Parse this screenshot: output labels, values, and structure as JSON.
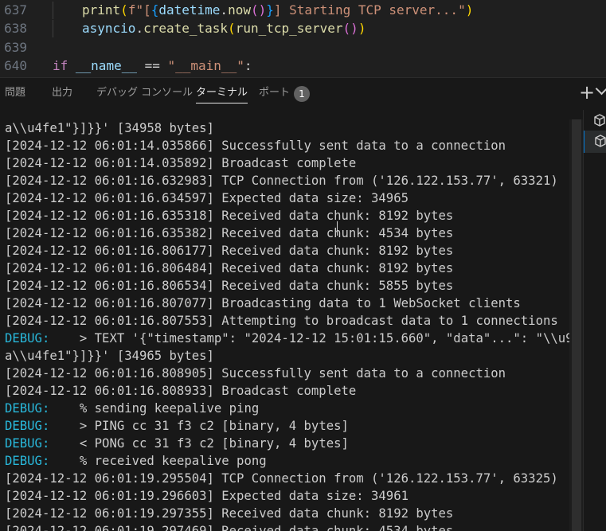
{
  "editor": {
    "lines": [
      {
        "num": "637",
        "indent": 1,
        "tokens": [
          {
            "t": "print",
            "c": "c-fn"
          },
          {
            "t": "(",
            "c": "c-br1"
          },
          {
            "t": "f\"[",
            "c": "c-str"
          },
          {
            "t": "{",
            "c": "c-br3"
          },
          {
            "t": "datetime",
            "c": "c-var"
          },
          {
            "t": ".",
            "c": "c-pun"
          },
          {
            "t": "now",
            "c": "c-fn"
          },
          {
            "t": "()",
            "c": "c-br2"
          },
          {
            "t": "}",
            "c": "c-br3"
          },
          {
            "t": "] Starting TCP server...\"",
            "c": "c-str"
          },
          {
            "t": ")",
            "c": "c-br1"
          }
        ]
      },
      {
        "num": "638",
        "indent": 1,
        "tokens": [
          {
            "t": "asyncio",
            "c": "c-var"
          },
          {
            "t": ".",
            "c": "c-pun"
          },
          {
            "t": "create_task",
            "c": "c-fn"
          },
          {
            "t": "(",
            "c": "c-br1"
          },
          {
            "t": "run_tcp_server",
            "c": "c-fn"
          },
          {
            "t": "()",
            "c": "c-br2"
          },
          {
            "t": ")",
            "c": "c-br1"
          }
        ]
      },
      {
        "num": "639",
        "indent": 0,
        "tokens": []
      },
      {
        "num": "640",
        "indent": 0,
        "tokens": [
          {
            "t": "if ",
            "c": "c-kw"
          },
          {
            "t": "__name__",
            "c": "c-var"
          },
          {
            "t": " == ",
            "c": "c-pun"
          },
          {
            "t": "\"__main__\"",
            "c": "c-str"
          },
          {
            "t": ":",
            "c": "c-pun"
          }
        ]
      }
    ]
  },
  "panel": {
    "tabs": [
      {
        "label": "問題",
        "active": false
      },
      {
        "label": "出力",
        "active": false
      },
      {
        "label": "デバッグ コンソール",
        "active": false
      },
      {
        "label": "ターミナル",
        "active": true
      },
      {
        "label": "ポート",
        "active": false
      }
    ],
    "ports_badge": "1",
    "add_icon": "plus-icon",
    "dropdown_icon": "chevron-down-icon"
  },
  "terminal": {
    "lines": [
      {
        "debug": false,
        "text": "a\\\\u4fe1\"}]}}' [34958 bytes]"
      },
      {
        "debug": false,
        "text": "[2024-12-12 06:01:14.035866] Successfully sent data to a connection"
      },
      {
        "debug": false,
        "text": "[2024-12-12 06:01:14.035892] Broadcast complete"
      },
      {
        "debug": false,
        "text": "[2024-12-12 06:01:16.632983] TCP Connection from ('126.122.153.77', 63321)"
      },
      {
        "debug": false,
        "text": "[2024-12-12 06:01:16.634597] Expected data size: 34965"
      },
      {
        "debug": false,
        "text": "[2024-12-12 06:01:16.635318] Received data chunk: 8192 bytes"
      },
      {
        "debug": false,
        "text": "[2024-12-12 06:01:16.635382] Received data chunk: 4534 bytes"
      },
      {
        "debug": false,
        "text": "[2024-12-12 06:01:16.806177] Received data chunk: 8192 bytes"
      },
      {
        "debug": false,
        "text": "[2024-12-12 06:01:16.806484] Received data chunk: 8192 bytes"
      },
      {
        "debug": false,
        "text": "[2024-12-12 06:01:16.806534] Received data chunk: 5855 bytes"
      },
      {
        "debug": false,
        "text": "[2024-12-12 06:01:16.807077] Broadcasting data to 1 WebSocket clients"
      },
      {
        "debug": false,
        "text": "[2024-12-12 06:01:16.807553] Attempting to broadcast data to 1 connections"
      },
      {
        "debug": true,
        "tag": "DEBUG:",
        "text": "    > TEXT '{\"timestamp\": \"2024-12-12 15:01:15.660\", \"data\"...\": \"\\\\u901"
      },
      {
        "debug": false,
        "text": "a\\\\u4fe1\"}]}}' [34965 bytes]"
      },
      {
        "debug": false,
        "text": "[2024-12-12 06:01:16.808905] Successfully sent data to a connection"
      },
      {
        "debug": false,
        "text": "[2024-12-12 06:01:16.808933] Broadcast complete"
      },
      {
        "debug": true,
        "tag": "DEBUG:",
        "text": "    % sending keepalive ping"
      },
      {
        "debug": true,
        "tag": "DEBUG:",
        "text": "    > PING cc 31 f3 c2 [binary, 4 bytes]"
      },
      {
        "debug": true,
        "tag": "DEBUG:",
        "text": "    < PONG cc 31 f3 c2 [binary, 4 bytes]"
      },
      {
        "debug": true,
        "tag": "DEBUG:",
        "text": "    % received keepalive pong"
      },
      {
        "debug": false,
        "text": "[2024-12-12 06:01:19.295504] TCP Connection from ('126.122.153.77', 63325)"
      },
      {
        "debug": false,
        "text": "[2024-12-12 06:01:19.296603] Expected data size: 34961"
      },
      {
        "debug": false,
        "text": "[2024-12-12 06:01:19.297355] Received data chunk: 8192 bytes"
      },
      {
        "debug": false,
        "text": "[2024-12-12 06:01:19.297469] Received data chunk: 4534 bytes"
      }
    ]
  },
  "colors": {
    "debug_tag": "#29b8db",
    "accent": "#0078d4"
  }
}
